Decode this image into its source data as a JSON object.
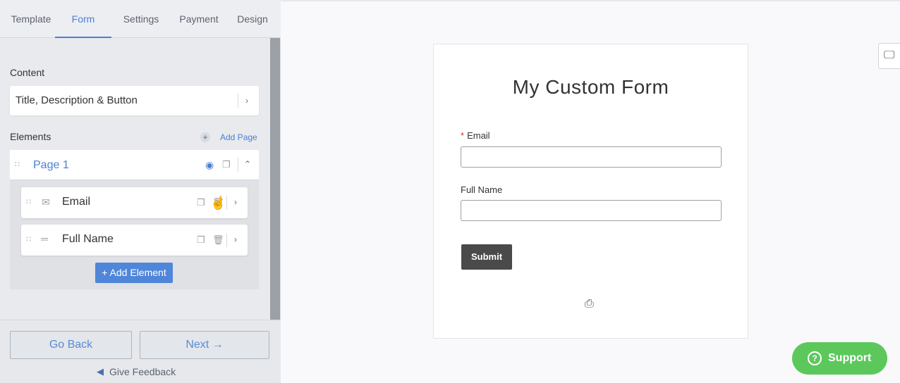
{
  "tabs": [
    {
      "label": "Template"
    },
    {
      "label": "Form"
    },
    {
      "label": "Settings"
    },
    {
      "label": "Payment"
    },
    {
      "label": "Design"
    }
  ],
  "active_tab": "Form",
  "sidebar": {
    "content_label": "Content",
    "content_item": "Title, Description & Button",
    "elements_label": "Elements",
    "add_page_label": "Add Page",
    "page": {
      "title": "Page 1",
      "elements": [
        {
          "name": "Email",
          "icon": "envelope-icon"
        },
        {
          "name": "Full Name",
          "icon": "text-line-icon"
        }
      ]
    },
    "add_element_label": "+ Add Element"
  },
  "footer": {
    "back_label": "Go Back",
    "next_label": "Next →",
    "feedback_label": "Give Feedback"
  },
  "preview": {
    "form_title": "My Custom Form",
    "fields": [
      {
        "label": "Email",
        "required": true
      },
      {
        "label": "Full Name",
        "required": false
      }
    ],
    "submit_label": "Submit"
  },
  "support_label": "Support",
  "colors": {
    "accent": "#4a7fd6",
    "support": "#5cc85c",
    "submit": "#4a4a4a",
    "required": "#d93025"
  }
}
